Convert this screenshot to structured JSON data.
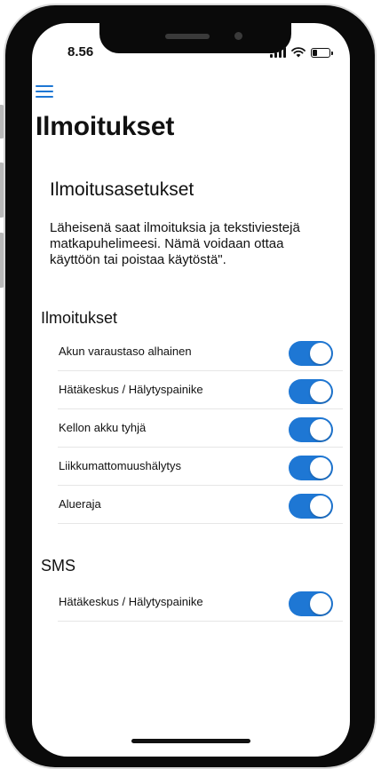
{
  "status_bar": {
    "time": "8.56",
    "icons": [
      "cellular-signal-icon",
      "wifi-icon",
      "battery-icon"
    ]
  },
  "nav": {
    "menu_icon": "hamburger-menu-icon",
    "title": "Ilmoitukset"
  },
  "settings": {
    "subtitle": "Ilmoitusasetukset",
    "description": "Läheisenä saat ilmoituksia ja tekstiviestejä matkapuhelimeesi. Nämä voidaan ottaa käyttöön tai poistaa käytöstä\"."
  },
  "notifications": {
    "header": "Ilmoitukset",
    "items": [
      {
        "label": "Akun varaustaso alhainen",
        "enabled": true
      },
      {
        "label": "Hätäkeskus / Hälytyspainike",
        "enabled": true
      },
      {
        "label": "Kellon akku tyhjä",
        "enabled": true
      },
      {
        "label": "Liikkumattomuushälytys",
        "enabled": true
      },
      {
        "label": "Alueraja",
        "enabled": true
      }
    ]
  },
  "sms": {
    "header": "SMS",
    "items": [
      {
        "label": "Hätäkeskus / Hälytyspainike",
        "enabled": true
      }
    ]
  },
  "colors": {
    "accent": "#1e77d4",
    "text": "#111111",
    "divider": "#e6e6e6",
    "phone_frame": "#0a0a0a"
  }
}
